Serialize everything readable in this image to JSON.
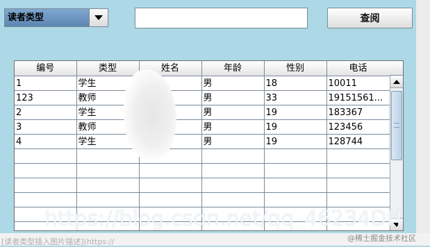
{
  "filter": {
    "reader_type_selected": "读者类型",
    "search_value": "",
    "query_label": "查阅"
  },
  "table": {
    "columns": [
      "编号",
      "类型",
      "姓名",
      "年龄",
      "性别",
      "电话"
    ],
    "rows": [
      [
        "1",
        "学生",
        "",
        "男",
        "18",
        "10011"
      ],
      [
        "123",
        "教师",
        "",
        "男",
        "33",
        "19151561..."
      ],
      [
        "2",
        "学生",
        "",
        "男",
        "19",
        "183367"
      ],
      [
        "3",
        "教师",
        "",
        "男",
        "19",
        "123456"
      ],
      [
        "4",
        "学生",
        "",
        "男",
        "19",
        "128744"
      ],
      [
        "",
        "",
        "",
        "",
        "",
        ""
      ],
      [
        "",
        "",
        "",
        "",
        "",
        ""
      ],
      [
        "",
        "",
        "",
        "",
        "",
        ""
      ],
      [
        "",
        "",
        "",
        "",
        "",
        ""
      ],
      [
        "",
        "",
        "",
        "",
        "",
        ""
      ],
      [
        "",
        "",
        "",
        "",
        "",
        ""
      ]
    ]
  },
  "overlay": {
    "watermark_url": "https://blog.csdn.net/qq_46234DH",
    "caption": "[读者类型插入图片描述](https://",
    "credit": "@稀土掘金技术社区"
  },
  "icons": {
    "combo_arrow": "chevron-down-icon",
    "scroll_up": "arrow-up-icon",
    "scroll_down": "arrow-down-icon"
  },
  "colors": {
    "background": "#add8e6",
    "combo_selected": "#6f97c2"
  }
}
